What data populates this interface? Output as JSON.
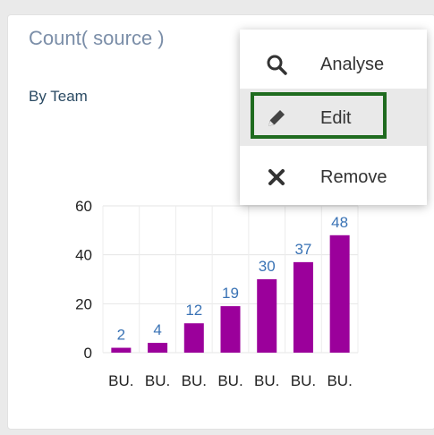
{
  "widget": {
    "title": "Count( source )",
    "subtitle": "By Team"
  },
  "menu": {
    "items": [
      {
        "label": "Analyse",
        "icon": "search-icon"
      },
      {
        "label": "Edit",
        "icon": "pencil-icon"
      },
      {
        "label": "Remove",
        "icon": "close-icon"
      }
    ],
    "highlighted_item": "Edit"
  },
  "colors": {
    "bar": "#9b009b",
    "value_label": "#3a73b5",
    "focus_border": "#1f6b1f"
  },
  "chart_data": {
    "type": "bar",
    "categories": [
      "BU.",
      "BU.",
      "BU.",
      "BU.",
      "BU.",
      "BU.",
      "BU."
    ],
    "values": [
      2,
      4,
      12,
      19,
      30,
      37,
      48
    ],
    "ylim": [
      0,
      60
    ],
    "yticks": [
      0,
      20,
      40,
      60
    ],
    "grid": true,
    "legend": "none"
  }
}
